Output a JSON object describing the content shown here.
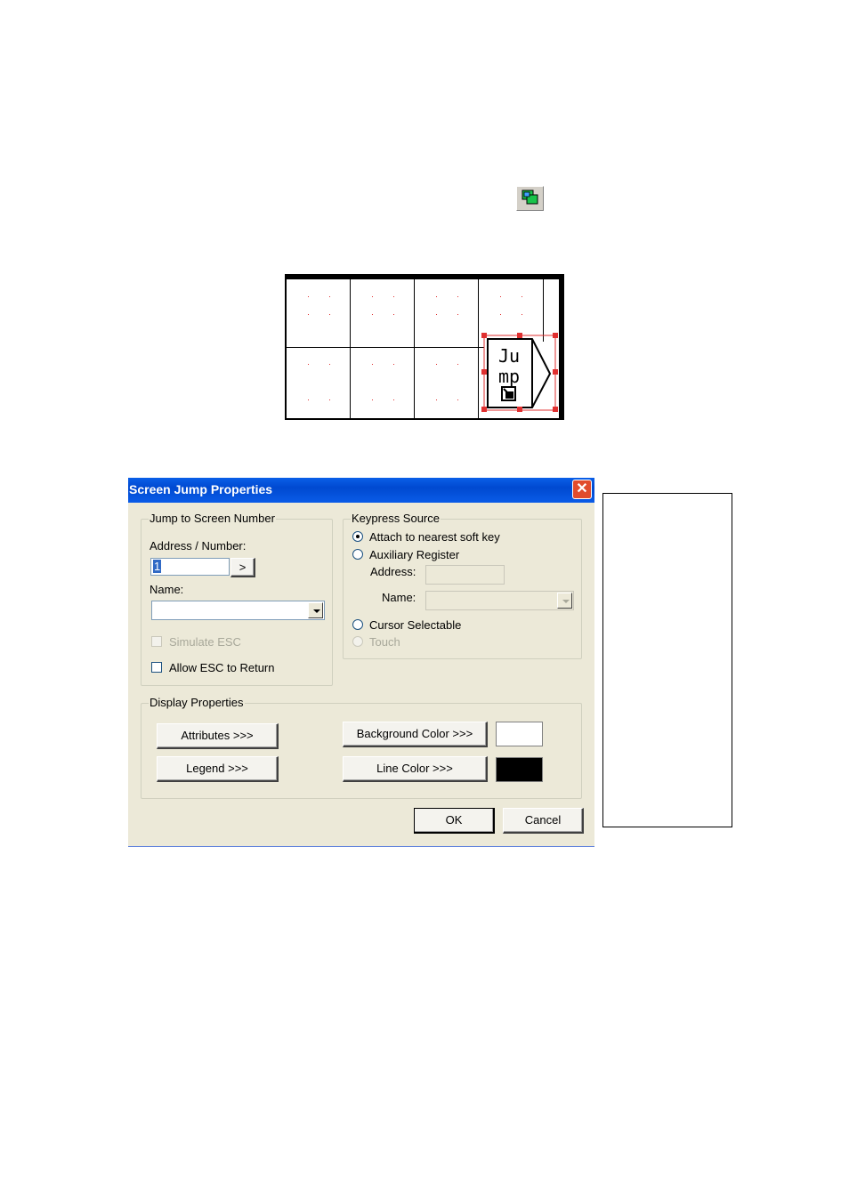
{
  "canvas": {
    "jump_label_line1": "Ju",
    "jump_label_line2": "mp"
  },
  "dialog": {
    "title": "Screen Jump Properties",
    "close_symbol": "✕",
    "jump_group": {
      "label": "Jump to Screen Number",
      "address_label": "Address / Number:",
      "address_value": "1",
      "browse_label": ">",
      "name_label": "Name:",
      "name_value": "",
      "simulate_esc_label": "Simulate ESC",
      "simulate_esc_checked": false,
      "allow_esc_label": "Allow ESC to Return",
      "allow_esc_checked": false
    },
    "keypress_group": {
      "label": "Keypress Source",
      "option_softkey": "Attach to nearest soft key",
      "option_aux": "Auxiliary Register",
      "address_label": "Address:",
      "name_label": "Name:",
      "option_cursor": "Cursor Selectable",
      "option_touch": "Touch",
      "selected": "Attach to nearest soft key"
    },
    "display_group": {
      "label": "Display Properties",
      "attributes_label": "Attributes >>>",
      "legend_label": "Legend >>>",
      "background_color_label": "Background Color >>>",
      "line_color_label": "Line Color >>>",
      "background_color": "#ffffff",
      "line_color": "#000000"
    },
    "ok_label": "OK",
    "cancel_label": "Cancel"
  }
}
